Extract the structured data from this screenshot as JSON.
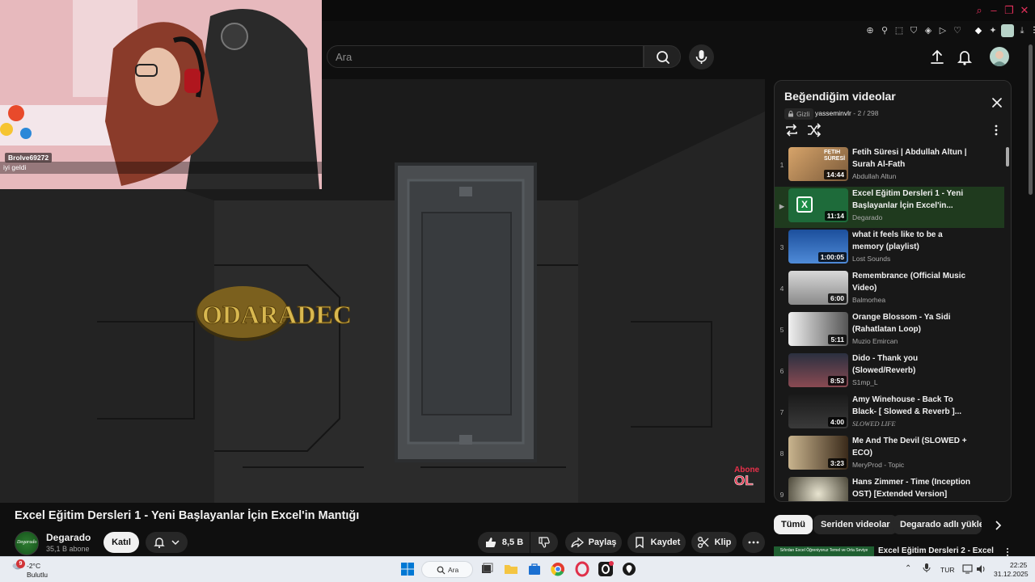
{
  "search": {
    "placeholder": "Ara"
  },
  "webcam": {
    "username": "Brolve69272",
    "message": "iyi geldi"
  },
  "player": {
    "watermark_text": "ODARADEC",
    "subscribe_badge_top": "Abone",
    "subscribe_badge_bottom": "OL"
  },
  "video": {
    "title": "Excel Eğitim Dersleri 1 - Yeni Başlayanlar İçin Excel'in Mantığı",
    "channel_name": "Degarado",
    "channel_avatar_text": "Degarado",
    "subscribers": "35,1 B abone",
    "join_label": "Katıl",
    "like_count": "8,5 B",
    "share_label": "Paylaş",
    "save_label": "Kaydet",
    "clip_label": "Klip"
  },
  "playlist": {
    "title": "Beğendiğim videolar",
    "privacy": "Gizli",
    "owner": "yasseminvlr",
    "position": "2 / 298",
    "items": [
      {
        "index": "1",
        "title": "Fetih Süresi | Abdullah Altun | Surah Al-Fath",
        "channel": "Abdullah Altun",
        "duration": "14:44",
        "thumb_text": "FETIH SÜRESİ"
      },
      {
        "index": "▶",
        "title": "Excel Eğitim Dersleri 1 - Yeni Başlayanlar İçin Excel'in...",
        "channel": "Degarado",
        "duration": "11:14"
      },
      {
        "index": "3",
        "title": "what it feels like to be a memory (playlist)",
        "channel": "Lost Sounds",
        "duration": "1:00:05"
      },
      {
        "index": "4",
        "title": "Remembrance (Official Music Video)",
        "channel": "Balmorhea",
        "duration": "6:00"
      },
      {
        "index": "5",
        "title": "Orange Blossom - Ya Sidi (Rahatlatan Loop)",
        "channel": "Muzio Emircan",
        "duration": "5:11"
      },
      {
        "index": "6",
        "title": "Dido - Thank you (Slowed/Reverb)",
        "channel": "S1mp_L",
        "duration": "8:53"
      },
      {
        "index": "7",
        "title": "Amy Winehouse - Back To Black- [ Slowed & Reverb ]...",
        "channel": "SLOWED LIFE",
        "duration": "4:00"
      },
      {
        "index": "8",
        "title": "Me And The Devil (SLOWED + ECO)",
        "channel": "MeryProd - Topic",
        "duration": "3:23"
      },
      {
        "index": "9",
        "title": "Hans Zimmer - Time (Inception OST) [Extended Version]",
        "channel": "",
        "duration": ""
      }
    ]
  },
  "chips": [
    "Tümü",
    "Seriden videolar",
    "Degarado adlı yükleyi"
  ],
  "next_video": {
    "title": "Excel Eğitim Dersleri 2 - Excel",
    "thumb_text": "Sıfırdan Excel Öğreniyoruz Temel ve Orta Seviye"
  },
  "taskbar": {
    "weather_badge": "9",
    "weather_temp": "-2°C",
    "weather_desc": "Bulutlu",
    "search_label": "Ara",
    "language": "TUR",
    "time": "22:25",
    "date": "31.12.2025"
  }
}
